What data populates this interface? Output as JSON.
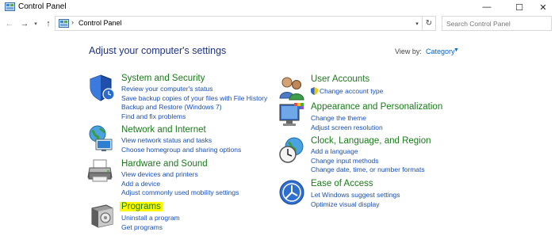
{
  "window": {
    "title": "Control Panel",
    "minimize_glyph": "—",
    "maximize_glyph": "☐",
    "close_glyph": "✕"
  },
  "navbar": {
    "back_glyph": "←",
    "forward_glyph": "→",
    "recent_glyph": "▾",
    "up_glyph": "↑",
    "breadcrumb_separator": "›",
    "address": "Control Panel",
    "dropdown_glyph": "▾",
    "refresh_glyph": "↻",
    "search_placeholder": "Search Control Panel"
  },
  "header": {
    "title": "Adjust your computer's settings",
    "view_by_label": "View by:",
    "view_by_value": "Category",
    "view_by_caret": "▼"
  },
  "categories_left": [
    {
      "icon": "shield-icon",
      "heading": "System and Security",
      "links": [
        "Review your computer's status",
        "Save backup copies of your files with File History",
        "Backup and Restore (Windows 7)",
        "Find and fix problems"
      ]
    },
    {
      "icon": "network-globe-icon",
      "heading": "Network and Internet",
      "links": [
        "View network status and tasks",
        "Choose homegroup and sharing options"
      ]
    },
    {
      "icon": "printer-icon",
      "heading": "Hardware and Sound",
      "links": [
        "View devices and printers",
        "Add a device",
        "Adjust commonly used mobility settings"
      ]
    },
    {
      "icon": "programs-box-icon",
      "heading": "Programs",
      "links": [
        "Uninstall a program",
        "Get programs"
      ]
    }
  ],
  "categories_right": [
    {
      "icon": "users-icon",
      "heading": "User Accounts",
      "links": [
        "Change account type"
      ]
    },
    {
      "icon": "monitor-palette-icon",
      "heading": "Appearance and Personalization",
      "links": [
        "Change the theme",
        "Adjust screen resolution"
      ]
    },
    {
      "icon": "clock-globe-icon",
      "heading": "Clock, Language, and Region",
      "links": [
        "Add a language",
        "Change input methods",
        "Change date, time, or number formats"
      ]
    },
    {
      "icon": "ease-of-access-icon",
      "heading": "Ease of Access",
      "links": [
        "Let Windows suggest settings",
        "Optimize visual display"
      ]
    }
  ],
  "colors": {
    "heading_green": "#1a7a1a",
    "link_blue": "#1a4fb5",
    "title_navy": "#1e3287",
    "highlight_yellow": "#fff700"
  }
}
